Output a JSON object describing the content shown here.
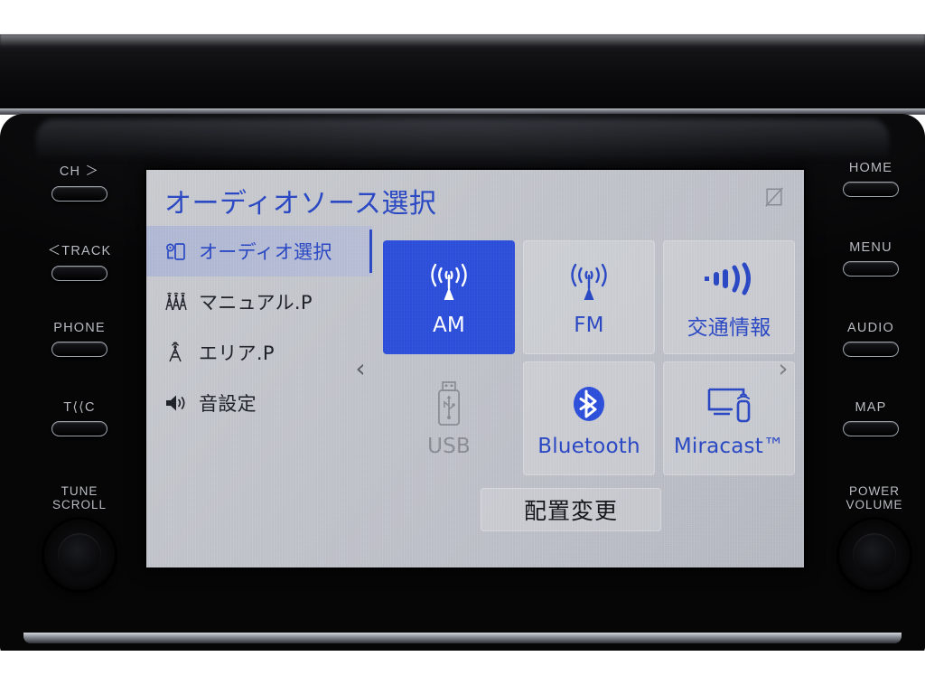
{
  "screen": {
    "title": "オーディオソース選択",
    "screen_off_icon": "display-off-icon",
    "accent_color": "#2b49c4",
    "selected_tile_color": "#2e50da",
    "background_color": "#c2c5cb"
  },
  "sidebar": {
    "items": [
      {
        "label": "オーディオ選択",
        "icon": "audio-source-device-icon",
        "active": true
      },
      {
        "label": "マニュアル.P",
        "icon": "manual-preset-antennas-icon",
        "active": false
      },
      {
        "label": "エリア.P",
        "icon": "area-preset-antenna-icon",
        "active": false
      },
      {
        "label": "音設定",
        "icon": "speaker-sound-settings-icon",
        "active": false
      }
    ]
  },
  "tiles": [
    {
      "label": "AM",
      "icon": "radio-antenna-icon",
      "state": "selected"
    },
    {
      "label": "FM",
      "icon": "radio-antenna-icon",
      "state": "normal"
    },
    {
      "label": "交通情報",
      "icon": "traffic-signal-waves-icon",
      "state": "normal"
    },
    {
      "label": "USB",
      "icon": "usb-stick-icon",
      "state": "disabled"
    },
    {
      "label": "Bluetooth",
      "icon": "bluetooth-icon",
      "state": "normal"
    },
    {
      "label": "Miracast™",
      "icon": "miracast-screen-phone-icon",
      "state": "normal"
    }
  ],
  "pager": {
    "prev": "‹",
    "next": "›"
  },
  "rearrange_button": {
    "label": "配置変更"
  },
  "hardware": {
    "left": [
      {
        "label": "CH ＞",
        "name": "ch-next-button"
      },
      {
        "label": "＜TRACK",
        "name": "track-previous-button"
      },
      {
        "label": "PHONE",
        "name": "phone-button"
      },
      {
        "label": "T⟨⟨C",
        "name": "t-connect-button"
      }
    ],
    "right": [
      {
        "label": "HOME",
        "name": "home-button"
      },
      {
        "label": "MENU",
        "name": "menu-button"
      },
      {
        "label": "AUDIO",
        "name": "audio-button"
      },
      {
        "label": "MAP",
        "name": "map-button"
      }
    ],
    "left_knob": {
      "line1": "TUNE",
      "line2": "SCROLL"
    },
    "right_knob": {
      "line1": "POWER",
      "line2": "VOLUME"
    }
  }
}
